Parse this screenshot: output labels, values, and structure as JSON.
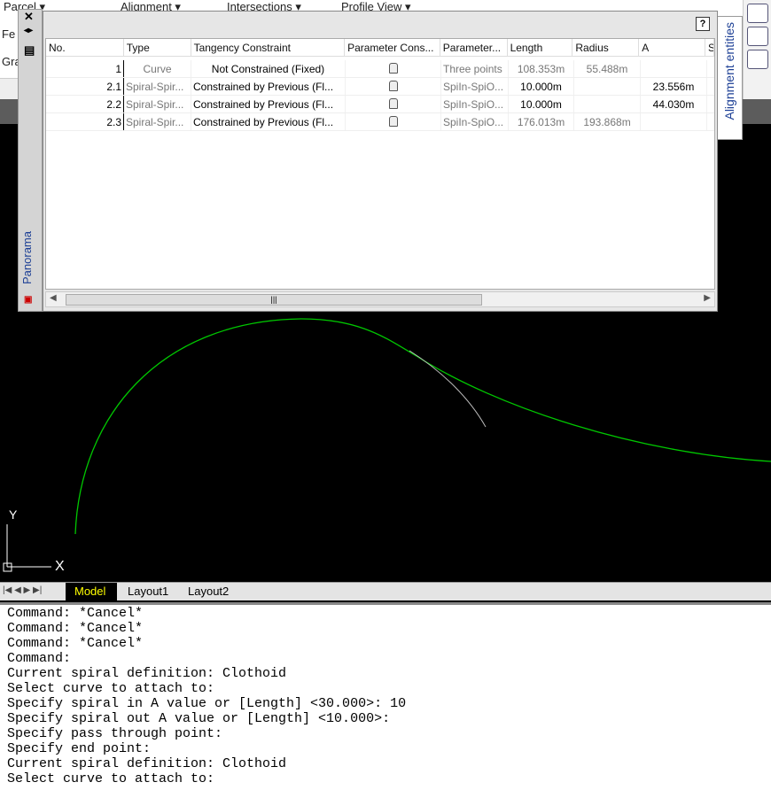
{
  "ribbon": {
    "items": [
      "Parcel ▾",
      "Alignment ▾",
      "Intersections ▾",
      "Profile View ▾",
      "Fe",
      "Gra"
    ]
  },
  "panel": {
    "side_label": "Panorama",
    "tab_label": "Alignment entities",
    "help": "?",
    "columns": [
      "No.",
      "Type",
      "Tangency Constraint",
      "Parameter Cons...",
      "Parameter...",
      "Length",
      "Radius",
      "A",
      "S"
    ],
    "rows": [
      {
        "no": "1",
        "type": "Curve",
        "tangency": "Not Constrained (Fixed)",
        "param": "Three points",
        "length": "108.353m",
        "radius": "55.488m",
        "a": ""
      },
      {
        "no": "2.1",
        "type": "Spiral-Spir...",
        "tangency": "Constrained by Previous (Fl...",
        "param": "SpiIn-SpiO...",
        "length": "10.000m",
        "radius": "",
        "a": "23.556m"
      },
      {
        "no": "2.2",
        "type": "Spiral-Spir...",
        "tangency": "Constrained by Previous (Fl...",
        "param": "SpiIn-SpiO...",
        "length": "10.000m",
        "radius": "",
        "a": "44.030m"
      },
      {
        "no": "2.3",
        "type": "Spiral-Spir...",
        "tangency": "Constrained by Previous (Fl...",
        "param": "SpiIn-SpiO...",
        "length": "176.013m",
        "radius": "193.868m",
        "a": ""
      }
    ]
  },
  "ucs": {
    "x": "X",
    "y": "Y"
  },
  "tabs": {
    "model": "Model",
    "layout1": "Layout1",
    "layout2": "Layout2"
  },
  "colors": {
    "alignment": "#00c800",
    "model_tab": "#ffff00"
  },
  "command_lines": [
    "Command: *Cancel*",
    "Command: *Cancel*",
    "Command: *Cancel*",
    "Command:",
    "Current spiral definition: Clothoid",
    "Select curve to attach to:",
    "Specify spiral in A value or [Length] <30.000>: 10",
    "Specify spiral out A value or [Length] <10.000>:",
    "Specify pass through point:",
    "Specify end point:",
    "Current spiral definition: Clothoid",
    "Select curve to attach to:"
  ]
}
